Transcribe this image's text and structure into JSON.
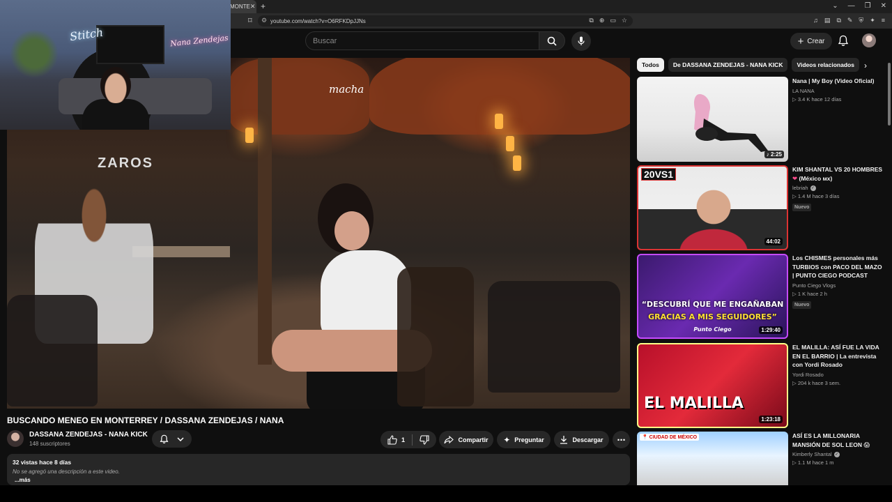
{
  "browser": {
    "tab_title": "MONTE",
    "url": "youtube.com/watch?v=O6RFKDpJJNs"
  },
  "header": {
    "search_placeholder": "Buscar",
    "create_label": "Crear"
  },
  "video": {
    "title": "BUSCANDO MENEO EN MONTERREY / DASSANA ZENDEJAS / NANA",
    "scene_sign_1": "ZAROS",
    "scene_sign_2": "macha",
    "channel_name": "DASSANA ZENDEJAS - NANA KICK",
    "subscribers": "148 suscriptores",
    "likes": "1",
    "share_label": "Compartir",
    "ask_label": "Preguntar",
    "download_label": "Descargar",
    "views_and_date": "32 vistas  hace 8 días",
    "no_description": "No se agregó una descripción a este video.",
    "more_label": "...más"
  },
  "webcam": {
    "sign_left": "Stitch",
    "sign_right": "Nana Zendejas"
  },
  "chips": {
    "items": [
      "Todos",
      "De DASSANA ZENDEJAS - NANA KICK",
      "Videos relacionados"
    ]
  },
  "recommendations": [
    {
      "title": "Nana | My Boy (Video Oficial)",
      "channel": "LA NANA",
      "meta": "▷ 3.4 K   hace 12 días",
      "duration": "♪ 2:25",
      "verified": false,
      "badge": ""
    },
    {
      "title": "KIM SHANTAL VS 20 HOMBRES",
      "title_suffix": "(México ᴍx)",
      "channel": "lebriah",
      "meta": "▷ 1.4 M   hace 3 días",
      "duration": "44:02",
      "verified": true,
      "badge": "Nuevo",
      "thumb_text": "20VS1"
    },
    {
      "title": "Los CHISMES personales más TURBIOS con PACO DEL MAZO | PUNTO CIEGO PODCAST",
      "channel": "Punto Ciego Vlogs",
      "meta": "▷ 1 K   hace 2 h",
      "duration": "1:29:40",
      "verified": false,
      "badge": "Nuevo",
      "thumb_text_1": "“DESCUBRÍ QUE ME ENGAÑABAN",
      "thumb_text_2": "GRACIAS A MIS SEGUIDORES”",
      "thumb_text_3": "Punto Ciego"
    },
    {
      "title": "EL MALILLA: ASÍ FUE LA VIDA EN EL BARRIO | La entrevista con Yordi Rosado",
      "channel": "Yordi Rosado",
      "meta": "▷ 204 k   hace 3 sem.",
      "duration": "1:23:18",
      "verified": false,
      "badge": "",
      "thumb_text": "EL MALILLA"
    },
    {
      "title": "ASÍ ES LA MILLONARIA MANSIÓN DE SOL LEON",
      "channel": "Kimberly Shantal",
      "meta": "▷ 1.1 M   hace 1 m",
      "duration": "",
      "verified": true,
      "badge": "",
      "thumb_text": "📍 CIUDAD DE MÉXICO"
    }
  ]
}
